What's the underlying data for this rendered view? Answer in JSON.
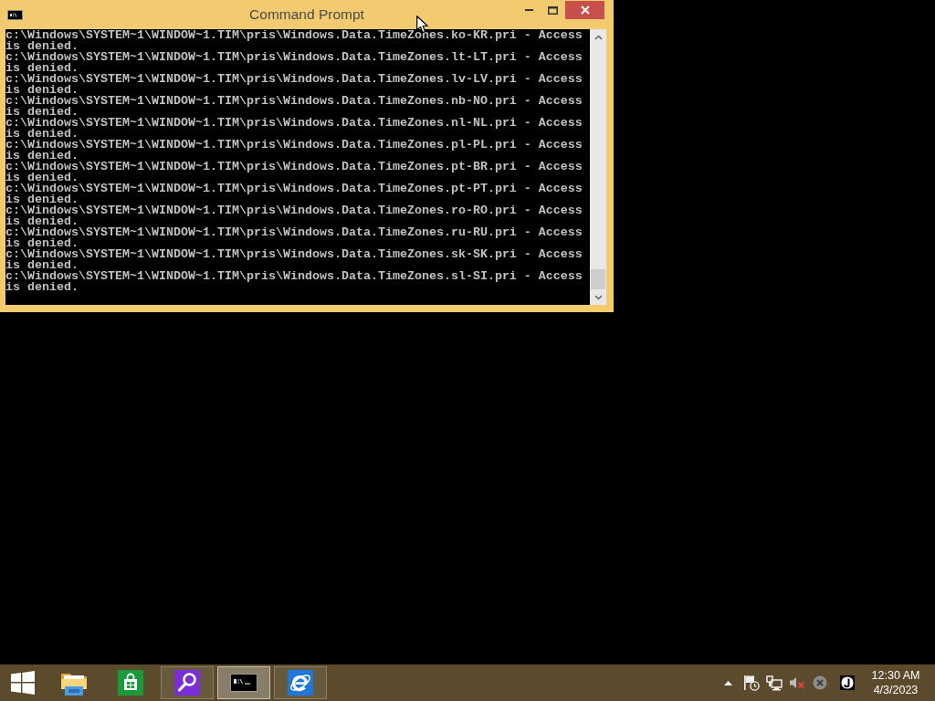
{
  "window": {
    "title": "Command Prompt",
    "console_lines": [
      "c:\\Windows\\SYSTEM~1\\WINDOW~1.TIM\\pris\\Windows.Data.TimeZones.ko-KR.pri - Access",
      "is denied.",
      "c:\\Windows\\SYSTEM~1\\WINDOW~1.TIM\\pris\\Windows.Data.TimeZones.lt-LT.pri - Access",
      "is denied.",
      "c:\\Windows\\SYSTEM~1\\WINDOW~1.TIM\\pris\\Windows.Data.TimeZones.lv-LV.pri - Access",
      "is denied.",
      "c:\\Windows\\SYSTEM~1\\WINDOW~1.TIM\\pris\\Windows.Data.TimeZones.nb-NO.pri - Access",
      "is denied.",
      "c:\\Windows\\SYSTEM~1\\WINDOW~1.TIM\\pris\\Windows.Data.TimeZones.nl-NL.pri - Access",
      "is denied.",
      "c:\\Windows\\SYSTEM~1\\WINDOW~1.TIM\\pris\\Windows.Data.TimeZones.pl-PL.pri - Access",
      "is denied.",
      "c:\\Windows\\SYSTEM~1\\WINDOW~1.TIM\\pris\\Windows.Data.TimeZones.pt-BR.pri - Access",
      "is denied.",
      "c:\\Windows\\SYSTEM~1\\WINDOW~1.TIM\\pris\\Windows.Data.TimeZones.pt-PT.pri - Access",
      "is denied.",
      "c:\\Windows\\SYSTEM~1\\WINDOW~1.TIM\\pris\\Windows.Data.TimeZones.ro-RO.pri - Access",
      "is denied.",
      "c:\\Windows\\SYSTEM~1\\WINDOW~1.TIM\\pris\\Windows.Data.TimeZones.ru-RU.pri - Access",
      "is denied.",
      "c:\\Windows\\SYSTEM~1\\WINDOW~1.TIM\\pris\\Windows.Data.TimeZones.sk-SK.pri - Access",
      "is denied.",
      "c:\\Windows\\SYSTEM~1\\WINDOW~1.TIM\\pris\\Windows.Data.TimeZones.sl-SI.pri - Access",
      "is denied."
    ]
  },
  "taskbar": {
    "items": [
      {
        "kind": "start",
        "running": false,
        "selected": false
      },
      {
        "kind": "file-explorer",
        "running": false,
        "selected": false
      },
      {
        "kind": "store",
        "running": false,
        "selected": false
      },
      {
        "kind": "search",
        "running": true,
        "selected": false
      },
      {
        "kind": "command-prompt",
        "running": true,
        "selected": true
      },
      {
        "kind": "internet-explorer",
        "running": true,
        "selected": false
      }
    ],
    "clock": {
      "time": "12:30 AM",
      "date": "4/3/2023"
    }
  }
}
